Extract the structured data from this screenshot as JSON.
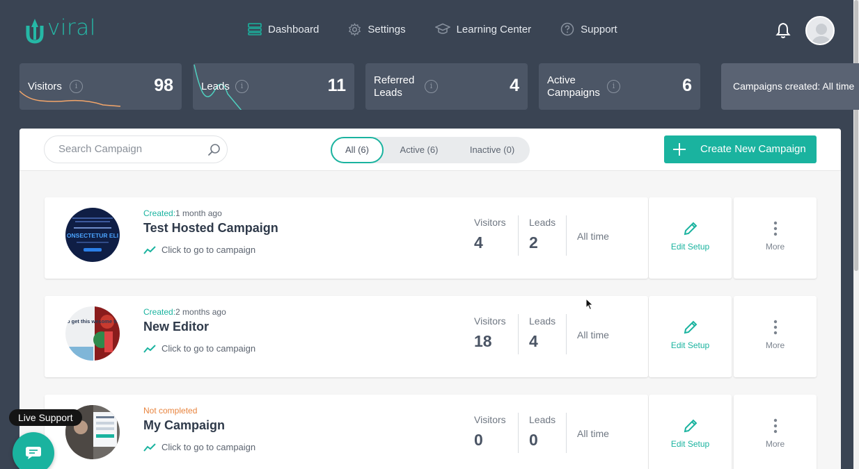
{
  "brand": {
    "logo_text": "viral",
    "logo_alt": "UpViral"
  },
  "nav": [
    {
      "label": "Dashboard",
      "icon": "dashboard-icon"
    },
    {
      "label": "Settings",
      "icon": "gear-icon"
    },
    {
      "label": "Learning Center",
      "icon": "graduation-cap-icon"
    },
    {
      "label": "Support",
      "icon": "question-icon"
    }
  ],
  "stats": {
    "visitors": {
      "label": "Visitors",
      "value": "98"
    },
    "leads": {
      "label": "Leads",
      "value": "11"
    },
    "referred": {
      "label_line1": "Referred",
      "label_line2": "Leads",
      "value": "4"
    },
    "active": {
      "label_line1": "Active",
      "label_line2": "Campaigns",
      "value": "6"
    },
    "period": "Campaigns created: All time"
  },
  "toolbar": {
    "search_placeholder": "Search Campaign",
    "filters": [
      {
        "label": "All (6)",
        "active": true
      },
      {
        "label": "Active (6)",
        "active": false
      },
      {
        "label": "Inactive (0)",
        "active": false
      }
    ],
    "create_label": "Create New Campaign"
  },
  "campaigns": [
    {
      "status_key": "Created:",
      "status_value": "1 month ago",
      "name": "Test Hosted Campaign",
      "goto": "Click to go to campaign",
      "visitors_label": "Visitors",
      "visitors": "4",
      "leads_label": "Leads",
      "leads": "2",
      "period": "All time",
      "edit": "Edit Setup",
      "more": "More",
      "thumb_text": "ONSECTETUR ELI"
    },
    {
      "status_key": "Created:",
      "status_value": "2 months ago",
      "name": "New Editor",
      "goto": "Click to go to campaign",
      "visitors_label": "Visitors",
      "visitors": "18",
      "leads_label": "Leads",
      "leads": "4",
      "period": "All time",
      "edit": "Edit Setup",
      "more": "More",
      "thumb_text": "o get this wesome tmas Tree FREE?"
    },
    {
      "status_key": "Not completed",
      "status_value": "",
      "name": "My Campaign",
      "goto": "Click to go to campaign",
      "visitors_label": "Visitors",
      "visitors": "0",
      "leads_label": "Leads",
      "leads": "0",
      "period": "All time",
      "edit": "Edit Setup",
      "more": "More"
    }
  ],
  "live_support": "Live Support",
  "colors": {
    "accent": "#1ab39f",
    "background": "#3a4453",
    "card": "#4c5666",
    "warning": "#e8843e"
  }
}
